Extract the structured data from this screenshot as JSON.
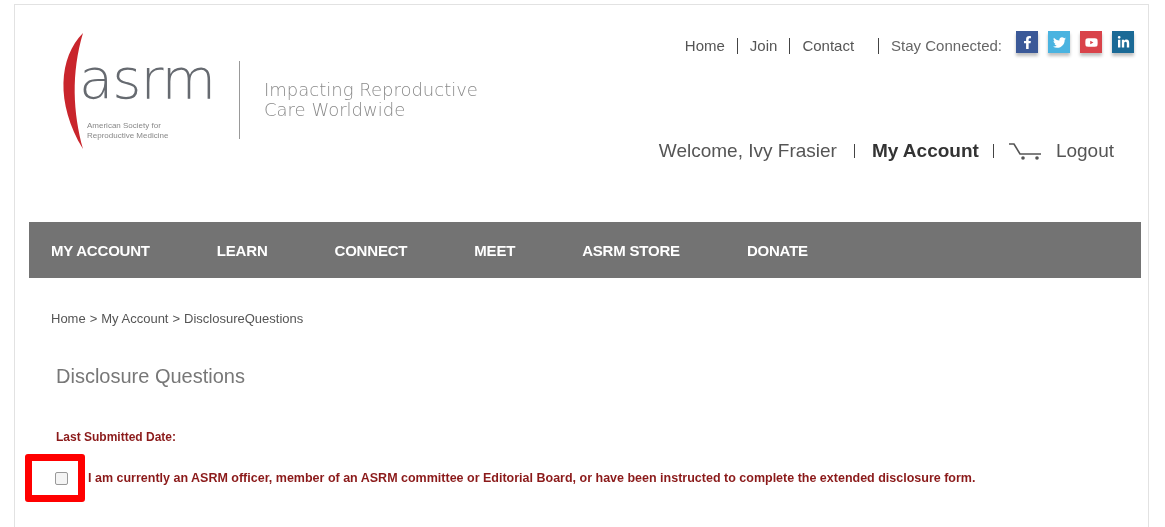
{
  "logo": {
    "wordmark": "asrm",
    "subtitle_lines": [
      "American Society for",
      "Reproductive Medicine"
    ],
    "tagline_lines": [
      "Impacting Reproductive",
      "Care Worldwide"
    ]
  },
  "top_links": [
    "Home",
    "Join",
    "Contact"
  ],
  "stay_connected": "Stay Connected:",
  "social_icons": [
    {
      "kind": "facebook"
    },
    {
      "kind": "twitter"
    },
    {
      "kind": "youtube"
    },
    {
      "kind": "linkedin"
    }
  ],
  "welcome": "Welcome, Ivy Frasier",
  "account_link": "My Account",
  "logout_link": "Logout",
  "nav_items": [
    "MY ACCOUNT",
    "LEARN",
    "CONNECT",
    "MEET",
    "ASRM STORE",
    "DONATE"
  ],
  "breadcrumb": [
    "Home",
    ">",
    "My Account",
    ">",
    "DisclosureQuestions"
  ],
  "heading": "Disclosure Questions",
  "last_submitted_label": "Last Submitted Date:",
  "disclosure_checkbox": {
    "checked": false,
    "label": "I am currently an ASRM officer, member of an ASRM committee or Editorial Board, or have been instructed to complete the extended disclosure form."
  }
}
